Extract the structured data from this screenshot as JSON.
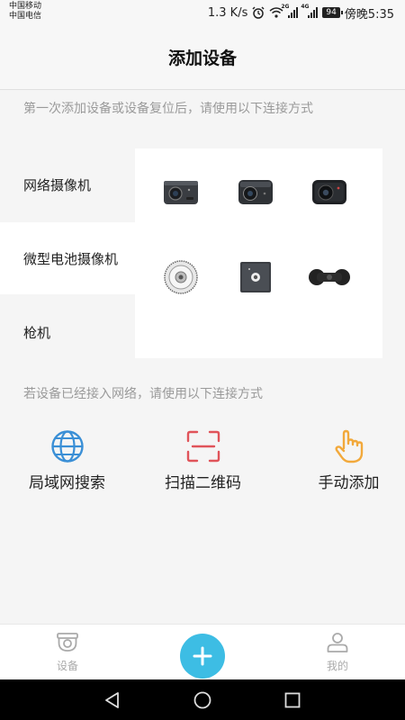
{
  "status_bar": {
    "carrier1": "中国移动",
    "carrier2": "中国电信",
    "speed": "1.3 K/s",
    "net1": "2G",
    "net2": "4G",
    "battery": "94",
    "time": "傍晚5:35"
  },
  "header": {
    "title": "添加设备"
  },
  "hint_first": "第一次添加设备或设备复位后，请使用以下连接方式",
  "categories": [
    {
      "label": "网络摄像机",
      "active": false
    },
    {
      "label": "微型电池摄像机",
      "active": true
    },
    {
      "label": "枪机",
      "active": false
    }
  ],
  "devices": [
    "camera-cube-1",
    "camera-cube-2",
    "camera-cube-3",
    "camera-round",
    "camera-square",
    "camera-bar"
  ],
  "hint_second": "若设备已经接入网络，请使用以下连接方式",
  "methods": [
    {
      "label": "局域网搜索",
      "icon": "globe-icon",
      "color": "#3a8fd6"
    },
    {
      "label": "扫描二维码",
      "icon": "scan-qr-icon",
      "color": "#e0545a"
    },
    {
      "label": "手动添加",
      "icon": "hand-pointer-icon",
      "color": "#f2a93b"
    }
  ],
  "tabbar": {
    "devices_label": "设备",
    "mine_label": "我的",
    "accent": "#3dbde4"
  }
}
